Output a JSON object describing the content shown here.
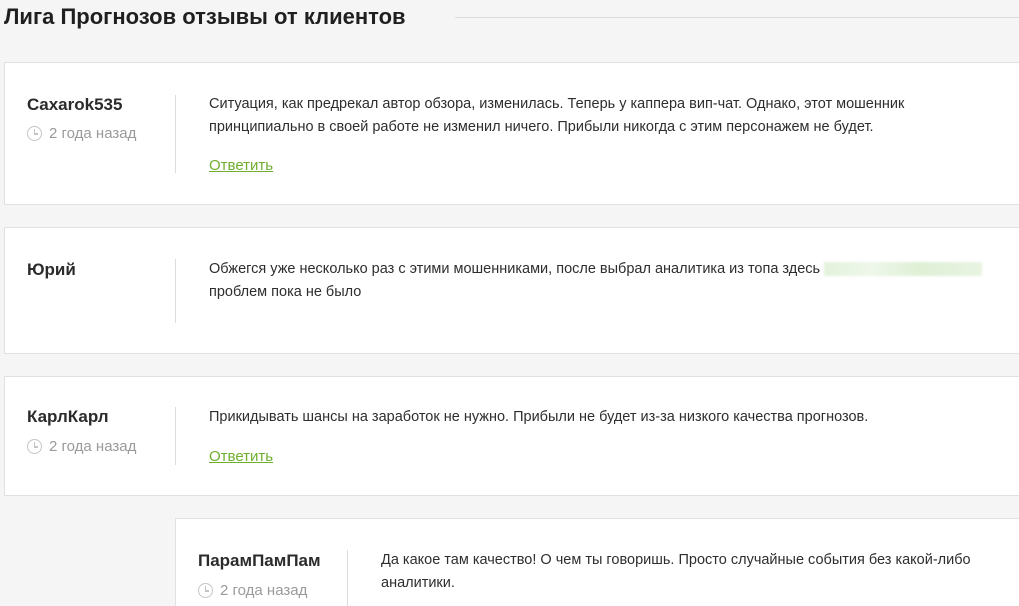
{
  "page": {
    "title": "Лига Прогнозов отзывы от клиентов"
  },
  "comments": [
    {
      "author": "Caxarok535",
      "date": "2 года назад",
      "text": "Ситуация, как предрекал автор обзора, изменилась. Теперь у каппера вип-чат. Однако, этот мошенник принципиально в своей работе не изменил ничего. Прибыли никогда с этим персонажем не будет.",
      "reply_label": "Ответить"
    },
    {
      "author": "Юрий",
      "text_before_link": "Обжегся уже несколько раз с этими мошенниками, после выбрал аналитика из топа здесь",
      "text_after_link": "проблем пока не было"
    },
    {
      "author": "КарлКарл",
      "date": "2 года назад",
      "text": "Прикидывать шансы на заработок не нужно. Прибыли не будет из-за низкого качества прогнозов.",
      "reply_label": "Ответить"
    },
    {
      "author": "ПарамПамПам",
      "date": "2 года назад",
      "text": "Да какое там качество! О чем ты говоришь. Просто случайные события без какой-либо аналитики."
    }
  ],
  "colors": {
    "accent_link": "#6fae2e",
    "meta_gray": "#9a9a9a",
    "card_border": "#e1e1e1"
  }
}
